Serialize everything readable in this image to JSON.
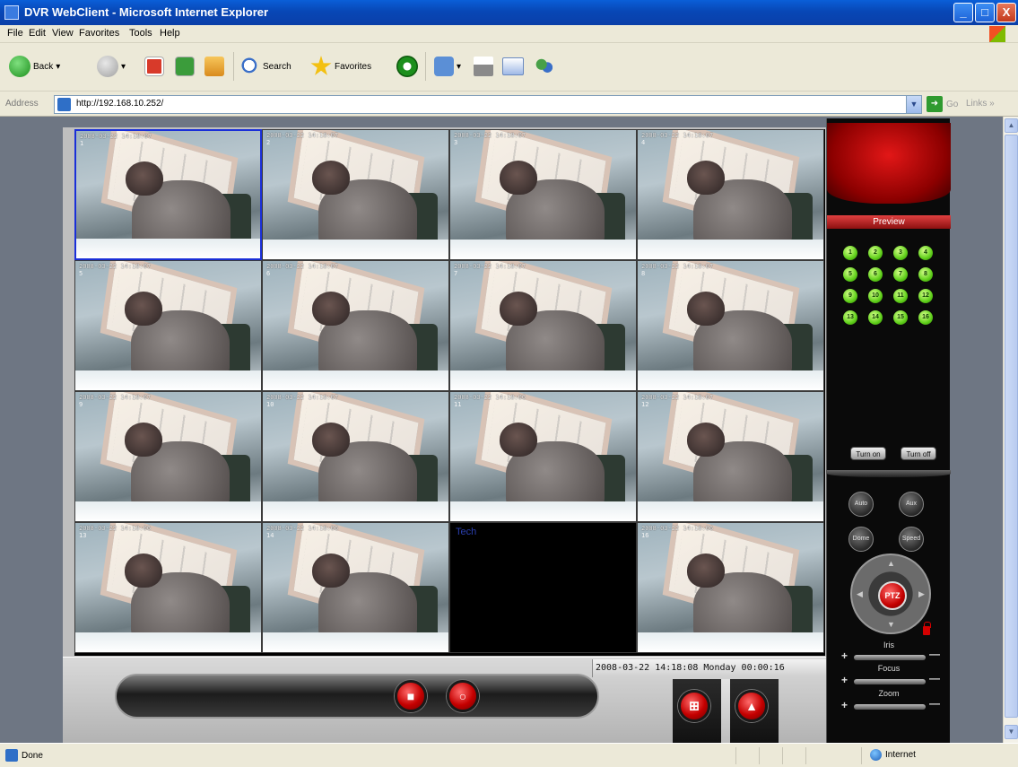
{
  "window": {
    "title": "DVR WebClient - Microsoft Internet Explorer",
    "controls": [
      "_",
      "□",
      "X"
    ]
  },
  "menu": [
    "File",
    "Edit",
    "View",
    "Favorites",
    "Tools",
    "Help"
  ],
  "toolbar": {
    "back_label": "Back",
    "search_label": "Search",
    "favorites_label": "Favorites"
  },
  "address": {
    "label": "Address",
    "url": "http://192.168.10.252/",
    "go_label": "Go",
    "links_label": "Links »"
  },
  "cameras": [
    {
      "ts": "2008-03-22 14:18:07",
      "num": "1",
      "selected": true
    },
    {
      "ts": "2008-03-22 14:18:07",
      "num": "2"
    },
    {
      "ts": "2008-03-22 14:18:07",
      "num": "3"
    },
    {
      "ts": "2008-03-22 14:18:07",
      "num": "4"
    },
    {
      "ts": "2008-03-22 14:18:07",
      "num": "5"
    },
    {
      "ts": "2008-03-22 14:18:07",
      "num": "6"
    },
    {
      "ts": "2008-03-22 14:18:07",
      "num": "7"
    },
    {
      "ts": "2008-03-22 14:18:07",
      "num": "8"
    },
    {
      "ts": "2008-03-22 14:18:07",
      "num": "9"
    },
    {
      "ts": "2008-03-22 14:18:07",
      "num": "10"
    },
    {
      "ts": "2008-03-22 14:18:06",
      "num": "11"
    },
    {
      "ts": "2008-03-22 14:18:07",
      "num": "12"
    },
    {
      "ts": "2008-03-22 14:18:06",
      "num": "13"
    },
    {
      "ts": "2008-03-22 14:18:06",
      "num": "14"
    },
    {
      "ts": "",
      "num": "",
      "empty_text": "Tech"
    },
    {
      "ts": "2008-03-22 14:18:06",
      "num": "16"
    }
  ],
  "status_info": "2008-03-22  14:18:08  Monday  00:00:16",
  "right_panel": {
    "preview_label": "Preview",
    "channels": [
      "1",
      "2",
      "3",
      "4",
      "5",
      "6",
      "7",
      "8",
      "9",
      "10",
      "11",
      "12",
      "13",
      "14",
      "15",
      "16"
    ],
    "turn_on": "Turn on",
    "turn_off": "Turn off",
    "auto_label": "Auto",
    "aux_label": "Aux",
    "dome_label": "Dome",
    "speed_label": "Speed",
    "ptz_label": "PTZ",
    "iris_label": "Iris",
    "focus_label": "Focus",
    "zoom_label": "Zoom"
  },
  "statusbar": {
    "done": "Done",
    "zone": "Internet"
  }
}
